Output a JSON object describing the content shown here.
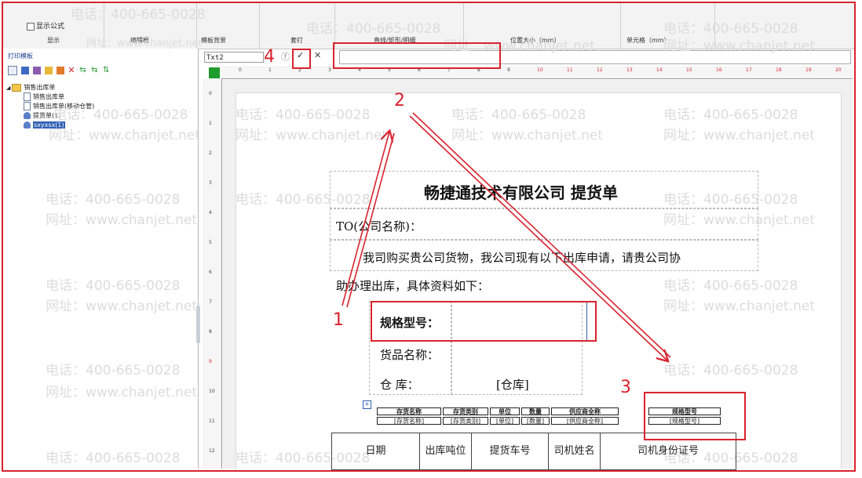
{
  "toolbar": {
    "show_formula_label": "显示公式",
    "groups": [
      "显示",
      "编辑框",
      "模板背景",
      "套打",
      "直线/矩形/明细",
      "位置大小（mm）",
      "单元格（mm）"
    ]
  },
  "left_panel": {
    "title": "打印模板",
    "tree": [
      {
        "label": "销售出库单"
      },
      {
        "label": "销售出库单"
      },
      {
        "label": "销售出库单(移动仓管)"
      },
      {
        "label": "提货单(1)"
      },
      {
        "label": "sxyxsx(1)"
      }
    ]
  },
  "formula_bar": {
    "namebox": "Txt2",
    "confirm_glyph": "✓",
    "cancel_glyph": "✕"
  },
  "ruler": {
    "h": [
      "0",
      "1",
      "2",
      "3",
      "4",
      "5",
      "6",
      "7",
      "8",
      "9",
      "10",
      "11",
      "12",
      "13",
      "14",
      "15",
      "16",
      "17",
      "18",
      "19",
      "20"
    ],
    "v": [
      "0",
      "1",
      "2",
      "3",
      "4",
      "5",
      "6",
      "7",
      "8",
      "9",
      "10",
      "11",
      "12"
    ]
  },
  "watermark": {
    "phone": "电话：400-665-0028",
    "site": "网址：www.chanjet.net"
  },
  "document": {
    "title": "畅捷通技术有限公司  提货单",
    "to_line": "TO(公司名称)：",
    "para_line1": "我司购买贵公司货物，我公司现有以下出库申请，请贵公司协",
    "para_line2": "助办理出库，具体资料如下：",
    "spec_label": "规格型号：",
    "product_label": "货品名称：",
    "warehouse_label": "仓      库：",
    "warehouse_value": "[仓库]",
    "mini_headers": [
      "存货名称",
      "存货类别",
      "单位",
      "数量",
      "供应商全称",
      "规格型号"
    ],
    "mini_values": [
      "[存货名称]",
      "[存货类别]",
      "[单位]",
      "[数量]",
      "[供应商全称]",
      "[规格型号]"
    ],
    "bottom_headers": [
      "日期",
      "出库吨位",
      "提货车号",
      "司机姓名",
      "司机身份证号"
    ]
  },
  "annotations": {
    "n1": "1",
    "n2": "2",
    "n3": "3",
    "n4": "4"
  },
  "colors": {
    "annotation": "#d9232e",
    "ruler_start": "#1f9c2d",
    "selection": "#2f5fb4"
  }
}
